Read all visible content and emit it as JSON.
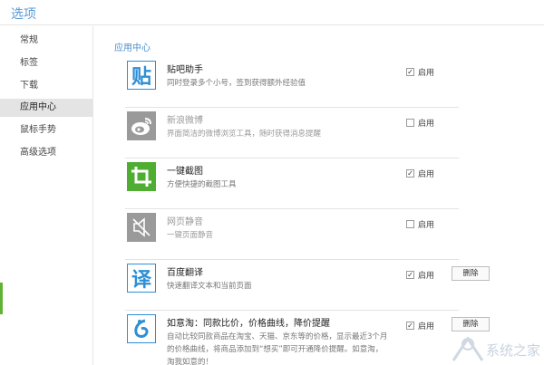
{
  "window": {
    "title": "选项"
  },
  "sidebar": {
    "items": [
      {
        "label": "常规",
        "active": false
      },
      {
        "label": "标签",
        "active": false
      },
      {
        "label": "下载",
        "active": false
      },
      {
        "label": "应用中心",
        "active": true
      },
      {
        "label": "鼠标手势",
        "active": false
      },
      {
        "label": "高级选项",
        "active": false
      }
    ]
  },
  "main": {
    "section_title": "应用中心",
    "plugins": [
      {
        "name": "贴吧助手",
        "description": "同时登录多个小号，签到获得额外经验值",
        "icon": "tieba-icon",
        "icon_text": "贴",
        "icon_color": "#2d8fd5",
        "enabled": true,
        "checkbox_label": "启用"
      },
      {
        "name": "新浪微博",
        "description": "界面简洁的微博浏览工具，随时获得消息提醒",
        "icon": "weibo-icon",
        "icon_color": "#9a9a9a",
        "enabled": false,
        "checkbox_label": "启用"
      },
      {
        "name": "一键截图",
        "description": "方便快捷的截图工具",
        "icon": "screenshot-icon",
        "icon_color": "#4fae32",
        "enabled": true,
        "checkbox_label": "启用"
      },
      {
        "name": "网页静音",
        "description": "一键页面静音",
        "icon": "mute-icon",
        "icon_color": "#9a9a9a",
        "enabled": false,
        "checkbox_label": "启用"
      },
      {
        "name": "百度翻译",
        "description": "快速翻译文本和当前页面",
        "icon": "translate-icon",
        "icon_text": "译",
        "icon_color": "#2d8fd5",
        "enabled": true,
        "checkbox_label": "启用",
        "delete_label": "删除"
      },
      {
        "name": "如意淘：同款比价，价格曲线，降价提醒",
        "description": "自动比较同款商品在淘宝、天猫、京东等的价格，显示最近3个月的价格曲线，将商品添加到“想买”即可开通降价提醒。如意淘，淘我如意的！",
        "icon": "ruyitao-icon",
        "icon_color": "#2d8fd5",
        "enabled": true,
        "checkbox_label": "启用",
        "delete_label": "删除"
      }
    ]
  },
  "watermark": {
    "text": "系统之家"
  },
  "colors": {
    "accent_blue": "#4a8fd0",
    "accent_green": "#5fb233"
  }
}
